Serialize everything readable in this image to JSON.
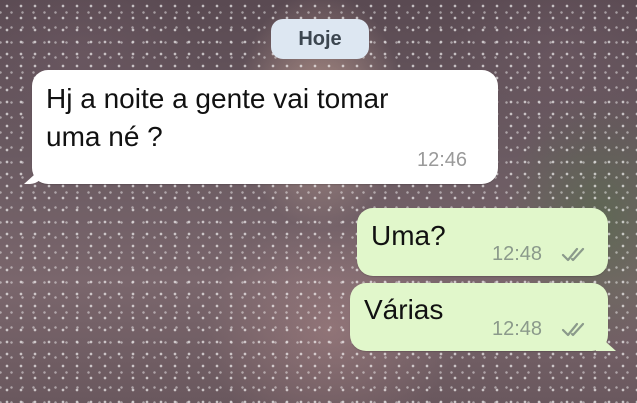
{
  "chat": {
    "date_label": "Hoje",
    "messages": [
      {
        "direction": "incoming",
        "text": "Hj a noite a gente vai tomar\numa né ?",
        "time": "12:46"
      },
      {
        "direction": "outgoing",
        "text": "Uma?",
        "time": "12:48",
        "status": "read-double-check-icon"
      },
      {
        "direction": "outgoing",
        "text": "Várias",
        "time": "12:48",
        "status": "read-double-check-icon"
      }
    ]
  },
  "colors": {
    "incoming_bubble": "#ffffff",
    "outgoing_bubble": "#e1f7cb",
    "date_pill": "#dde7f2",
    "checkmarks": "#8b9a8b"
  }
}
